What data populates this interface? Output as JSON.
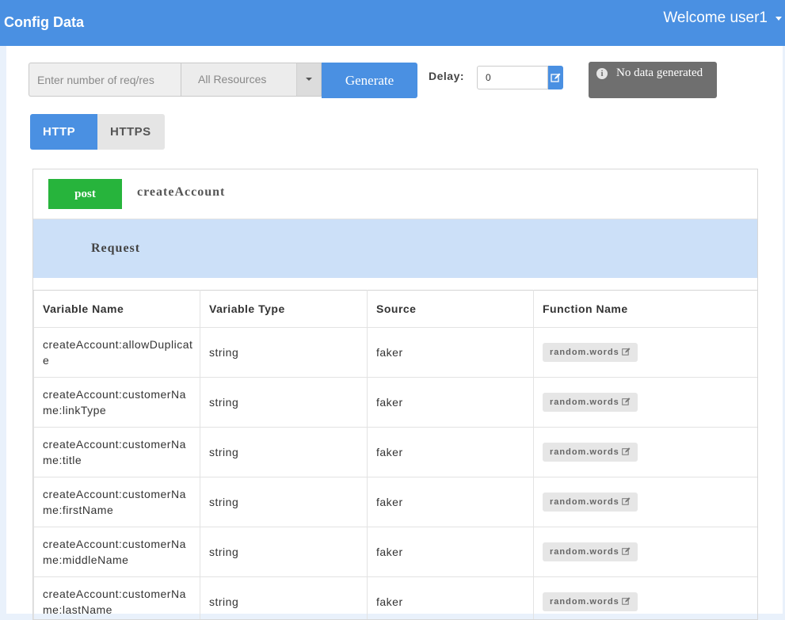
{
  "header": {
    "title": "Config Data",
    "user_label": "Welcome user1",
    "background": "#4a90e2"
  },
  "toolbar": {
    "count_placeholder": "Enter number of req/res",
    "resource_select_value": "All Resources",
    "generate_label": "Generate",
    "delay_label": "Delay:",
    "delay_value": "0",
    "status_icon": "info-icon",
    "status_text": "No data generated"
  },
  "protocol_tabs": [
    {
      "label": "HTTP",
      "active": true
    },
    {
      "label": "HTTPS",
      "active": false
    }
  ],
  "endpoint": {
    "method": "post",
    "method_color": "#27b43c",
    "name": "createAccount",
    "section_title": "Request",
    "columns": [
      "Variable Name",
      "Variable Type",
      "Source",
      "Function Name"
    ],
    "rows": [
      {
        "name": "createAccount:allowDuplicate",
        "type": "string",
        "source": "faker",
        "function": "random.words"
      },
      {
        "name": "createAccount:customerName:linkType",
        "type": "string",
        "source": "faker",
        "function": "random.words"
      },
      {
        "name": "createAccount:customerName:title",
        "type": "string",
        "source": "faker",
        "function": "random.words"
      },
      {
        "name": "createAccount:customerName:firstName",
        "type": "string",
        "source": "faker",
        "function": "random.words"
      },
      {
        "name": "createAccount:customerName:middleName",
        "type": "string",
        "source": "faker",
        "function": "random.words"
      },
      {
        "name": "createAccount:customerName:lastName",
        "type": "string",
        "source": "faker",
        "function": "random.words"
      }
    ]
  }
}
